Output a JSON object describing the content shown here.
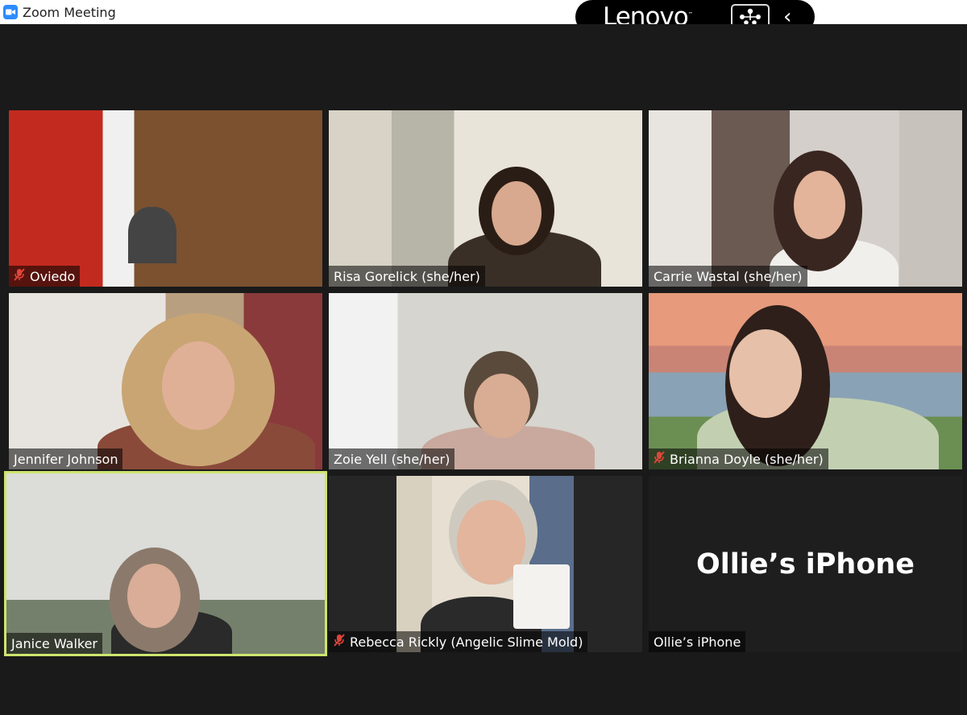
{
  "window": {
    "title": "Zoom Meeting"
  },
  "brand": {
    "logo": "Lenovo"
  },
  "participants": [
    {
      "name": "Oviedo",
      "muted": true
    },
    {
      "name": "Risa Gorelick (she/her)",
      "muted": false
    },
    {
      "name": "Carrie Wastal (she/her)",
      "muted": false
    },
    {
      "name": "Jennifer Johnson",
      "muted": false
    },
    {
      "name": "Zoie Yell (she/her)",
      "muted": false
    },
    {
      "name": "Brianna Doyle (she/her)",
      "muted": true
    },
    {
      "name": "Janice Walker",
      "muted": false,
      "active_speaker": true
    },
    {
      "name": "Rebecca Rickly (Angelic Slime Mold)",
      "muted": true
    },
    {
      "name": "Ollie’s iPhone",
      "muted": false,
      "video_off": true
    }
  ],
  "ollie_center": "Ollie’s iPhone",
  "colors": {
    "active_speaker_border": "#cde56e",
    "muted_icon": "#e0453a",
    "zoom_blue": "#2d8cff"
  }
}
